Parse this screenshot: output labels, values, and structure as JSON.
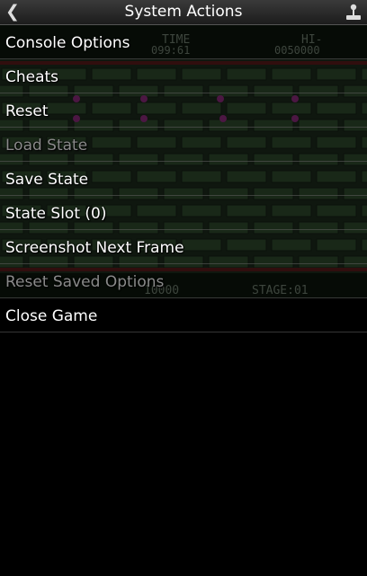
{
  "header": {
    "title": "System Actions",
    "back_icon": "chevron-left-icon",
    "right_icon": "joystick-icon"
  },
  "menu": [
    {
      "label": "Console Options",
      "enabled": true
    },
    {
      "label": "Cheats",
      "enabled": true
    },
    {
      "label": "Reset",
      "enabled": true
    },
    {
      "label": "Load State",
      "enabled": false
    },
    {
      "label": "Save State",
      "enabled": true
    },
    {
      "label": "State Slot (0)",
      "enabled": true
    },
    {
      "label": "Screenshot Next Frame",
      "enabled": true
    },
    {
      "label": "Reset Saved Options",
      "enabled": false
    },
    {
      "label": "Close Game",
      "enabled": true
    }
  ],
  "game_hud": {
    "time_label": "TIME",
    "time_value": "099:61",
    "hi_label": "HI-",
    "hi_value": "0050000",
    "score_value": "10000",
    "stage_label": "STAGE:01"
  }
}
